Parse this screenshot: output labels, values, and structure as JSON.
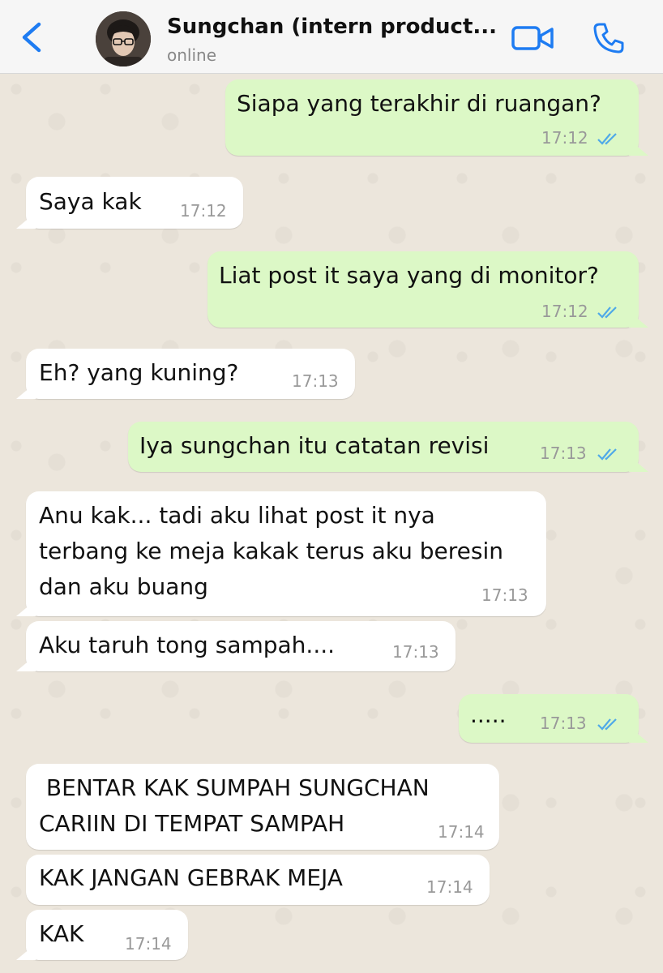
{
  "header": {
    "back_icon": "chevron-left-icon",
    "contact_name": "Sungchan (intern product...",
    "status": "online",
    "video_icon": "video-camera-icon",
    "phone_icon": "phone-icon"
  },
  "colors": {
    "accent": "#1E7CF2",
    "incoming_bubble": "#FFFFFF",
    "outgoing_bubble": "#DCF8C6",
    "read_ticks": "#4FA9E8"
  },
  "messages": [
    {
      "direction": "outgoing",
      "text": "Siapa yang terakhir di ruangan?",
      "time": "17:12",
      "status": "read"
    },
    {
      "direction": "incoming",
      "text": "Saya kak",
      "time": "17:12"
    },
    {
      "direction": "outgoing",
      "text": "Liat post it saya yang di monitor?",
      "time": "17:12",
      "status": "read"
    },
    {
      "direction": "incoming",
      "text": "Eh? yang kuning?",
      "time": "17:13"
    },
    {
      "direction": "outgoing",
      "text": "Iya sungchan itu catatan revisi",
      "time": "17:13",
      "status": "read"
    },
    {
      "direction": "incoming",
      "text": "Anu kak... tadi aku lihat post it nya\nterbang ke meja kakak terus aku beresin\ndan aku buang",
      "time": "17:13"
    },
    {
      "direction": "incoming",
      "text": "Aku taruh tong sampah....",
      "time": "17:13"
    },
    {
      "direction": "outgoing",
      "text": ".....",
      "time": "17:13",
      "status": "read"
    },
    {
      "direction": "incoming",
      "text": " BENTAR KAK SUMPAH SUNGCHAN\nCARIIN DI TEMPAT SAMPAH",
      "time": "17:14"
    },
    {
      "direction": "incoming",
      "text": "KAK JANGAN GEBRAK MEJA",
      "time": "17:14"
    },
    {
      "direction": "incoming",
      "text": "KAK",
      "time": "17:14"
    }
  ]
}
